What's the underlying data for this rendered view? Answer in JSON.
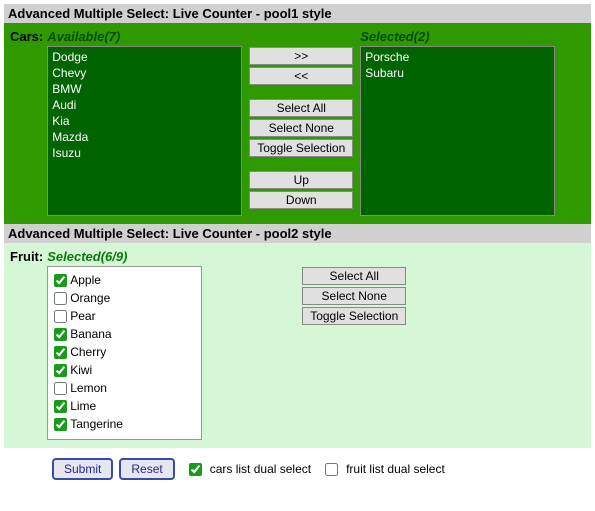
{
  "pool1": {
    "title": "Advanced Multiple Select: Live Counter - pool1 style",
    "field_label": "Cars:",
    "available_header": "Available(7)",
    "selected_header": "Selected(2)",
    "available": [
      "Dodge",
      "Chevy",
      "BMW",
      "Audi",
      "Kia",
      "Mazda",
      "Isuzu"
    ],
    "selected": [
      "Porsche",
      "Subaru"
    ],
    "btn_move_right": ">>",
    "btn_move_left": "<<",
    "btn_select_all": "Select All",
    "btn_select_none": "Select None",
    "btn_toggle": "Toggle Selection",
    "btn_up": "Up",
    "btn_down": "Down"
  },
  "pool2": {
    "title": "Advanced Multiple Select: Live Counter - pool2 style",
    "field_label": "Fruit:",
    "header": "Selected(6/9)",
    "items": [
      {
        "label": "Apple",
        "checked": true
      },
      {
        "label": "Orange",
        "checked": false
      },
      {
        "label": "Pear",
        "checked": false
      },
      {
        "label": "Banana",
        "checked": true
      },
      {
        "label": "Cherry",
        "checked": true
      },
      {
        "label": "Kiwi",
        "checked": true
      },
      {
        "label": "Lemon",
        "checked": false
      },
      {
        "label": "Lime",
        "checked": true
      },
      {
        "label": "Tangerine",
        "checked": true
      }
    ],
    "btn_select_all": "Select All",
    "btn_select_none": "Select None",
    "btn_toggle": "Toggle Selection"
  },
  "footer": {
    "submit": "Submit",
    "reset": "Reset",
    "cars_check_label": "cars list dual select",
    "cars_checked": true,
    "fruit_check_label": "fruit list dual select",
    "fruit_checked": false
  }
}
